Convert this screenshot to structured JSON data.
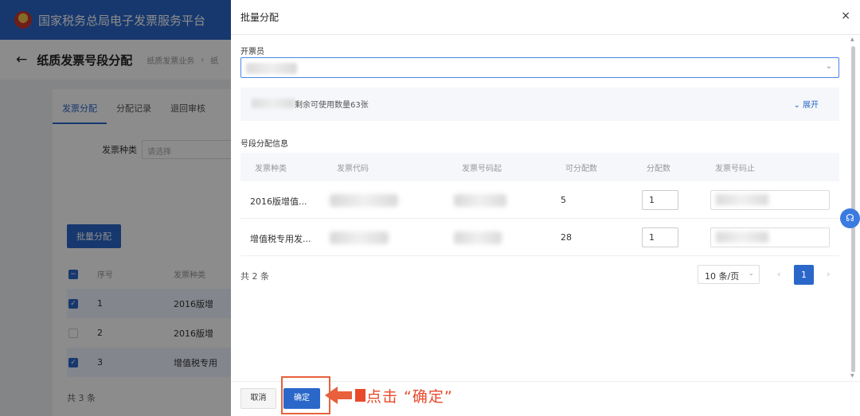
{
  "app": {
    "title": "国家税务总局电子发票服务平台"
  },
  "page": {
    "title": "纸质发票号段分配",
    "breadcrumb": [
      "纸质发票业务",
      "纸"
    ]
  },
  "bg_tabs": [
    "发票分配",
    "分配记录",
    "退回审核"
  ],
  "bg_filter": {
    "label": "发票种类",
    "placeholder": "请选择"
  },
  "bg_batch_button": "批量分配",
  "bg_table": {
    "headers": [
      "序号",
      "发票种类"
    ],
    "rows": [
      {
        "index": "1",
        "type": "2016版增",
        "checked": true
      },
      {
        "index": "2",
        "type": "2016版增",
        "checked": false
      },
      {
        "index": "3",
        "type": "增值税专用",
        "checked": true
      }
    ],
    "total": "共 3 条"
  },
  "drawer": {
    "title": "批量分配",
    "close": "×",
    "operator_label": "开票员",
    "info_text": "剩余可使用数量63张",
    "expand_label": "展开",
    "section_label": "号段分配信息",
    "table": {
      "headers": [
        "发票种类",
        "发票代码",
        "发票号码起",
        "可分配数",
        "分配数",
        "发票号码止"
      ],
      "rows": [
        {
          "type": "2016版增值...",
          "available": "5",
          "assign": "1"
        },
        {
          "type": "增值税专用发...",
          "available": "28",
          "assign": "1"
        }
      ]
    },
    "total": "共 2 条",
    "page_size": "10 条/页",
    "current_page": "1",
    "cancel_label": "取消",
    "confirm_label": "确定"
  },
  "annotation": {
    "text": "点击 “确定”"
  },
  "colors": {
    "primary": "#2a67c9",
    "annotation": "#e8492a"
  },
  "icons": {
    "back": "arrow-left-icon",
    "close": "close-icon",
    "expand": "chevron-down-icon",
    "support": "headset-icon"
  }
}
